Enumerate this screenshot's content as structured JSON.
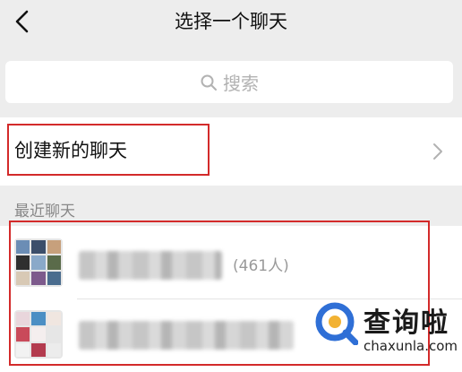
{
  "header": {
    "title": "选择一个聊天"
  },
  "search": {
    "placeholder": "搜索"
  },
  "new_chat": {
    "label": "创建新的聊天"
  },
  "recent": {
    "section_label": "最近聊天",
    "chats": [
      {
        "name_visible": "",
        "member_count": "(461人)"
      },
      {
        "name_visible": "",
        "member_count": ""
      }
    ]
  },
  "highlight_color": "#d32a2a",
  "watermark": {
    "name": "查询啦",
    "url": "chaxunla.com",
    "brand_color": "#2f6fd6"
  }
}
